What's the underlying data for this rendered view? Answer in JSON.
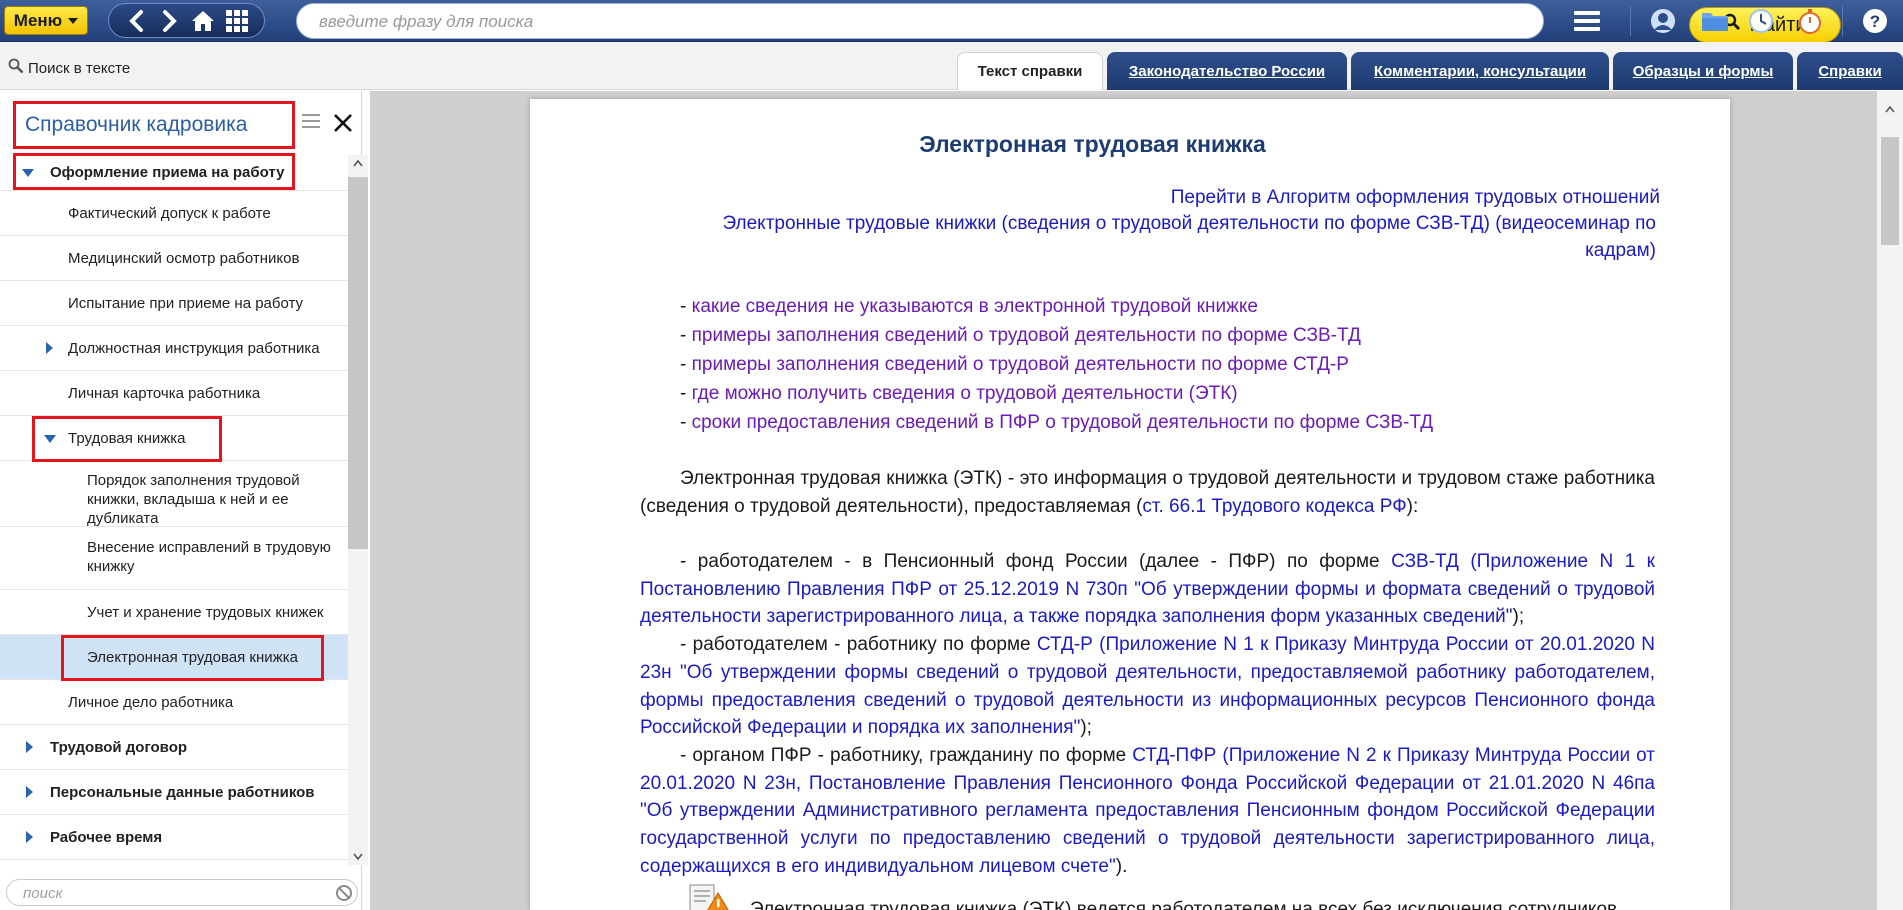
{
  "topbar": {
    "menu_label": "Меню",
    "search_placeholder": "введите фразу для поиска",
    "find_label": "Найти",
    "nav_icons": [
      "back-icon",
      "forward-icon",
      "home-icon",
      "grid-icon"
    ],
    "right_icons": [
      "hamburger-icon",
      "user-icon",
      "folder-icon",
      "clock-icon",
      "stopwatch-icon",
      "help-icon"
    ]
  },
  "toolbar": {
    "search_in_text": "Поиск в тексте",
    "tabs": [
      {
        "label": "Текст справки",
        "active": true
      },
      {
        "label": "Законодательство России",
        "active": false
      },
      {
        "label": "Комментарии, консультации",
        "active": false
      },
      {
        "label": "Образцы и формы",
        "active": false
      },
      {
        "label": "Справки",
        "active": false
      }
    ]
  },
  "sidebar": {
    "title": "Справочник кадровика",
    "search_placeholder": "поиск",
    "items": [
      {
        "label": "Оформление приема на работу",
        "level": 0,
        "expanded": true,
        "bold": true
      },
      {
        "label": "Фактический допуск к работе",
        "level": 1
      },
      {
        "label": "Медицинский осмотр работников",
        "level": 1
      },
      {
        "label": "Испытание при приеме на работу",
        "level": 1
      },
      {
        "label": "Должностная инструкция работника",
        "level": 1,
        "collapsed": true
      },
      {
        "label": "Личная карточка работника",
        "level": 1
      },
      {
        "label": "Трудовая книжка",
        "level": 1,
        "expanded": true
      },
      {
        "label": "Порядок заполнения трудовой книжки, вкладыша к ней и ее дубликата",
        "level": 2
      },
      {
        "label": "Внесение исправлений в трудовую книжку",
        "level": 2
      },
      {
        "label": "Учет и хранение трудовых книжек",
        "level": 2
      },
      {
        "label": "Электронная трудовая книжка",
        "level": 2,
        "selected": true
      },
      {
        "label": "Личное дело работника",
        "level": 1
      },
      {
        "label": "Трудовой договор",
        "level": 0,
        "collapsed": true,
        "bold": true
      },
      {
        "label": "Персональные данные работников",
        "level": 0,
        "collapsed": true,
        "bold": true
      },
      {
        "label": "Рабочее время",
        "level": 0,
        "collapsed": true,
        "bold": true
      }
    ]
  },
  "document": {
    "title": "Электронная трудовая книжка",
    "top_links": [
      "Перейти в Алгоритм оформления трудовых отношений",
      "Электронные трудовые книжки (сведения о трудовой деятельности по форме СЗВ-ТД) (видеосеминар по",
      "кадрам)"
    ],
    "bullet_prefix": "- ",
    "bullets": [
      "какие сведения не указываются в электронной трудовой книжке",
      "примеры заполнения сведений о трудовой деятельности по форме СЗВ-ТД",
      "примеры заполнения сведений о трудовой деятельности по форме СТД-Р",
      "где можно получить сведения о трудовой деятельности (ЭТК)",
      "сроки предоставления сведений в ПФР о трудовой деятельности по форме СЗВ-ТД"
    ],
    "intro": {
      "text_before": "Электронная трудовая книжка (ЭТК) - это информация о трудовой деятельности и трудовом стаже работника (сведения о трудовой деятельности), предоставляемая (",
      "link": "ст. 66.1 Трудового кодекса РФ",
      "text_after": "):"
    },
    "items": [
      {
        "before": "- работодателем - в Пенсионный фонд России (далее - ПФР) по форме ",
        "form": "СЗВ-ТД",
        "mid": " (",
        "ref": "Приложение N 1 к Постановлению Правления ПФР от 25.12.2019 N 730п \"Об утверждении формы и формата сведений о трудовой деятельности зарегистрированного лица, а также порядка заполнения форм указанных сведений\"",
        "end": ");"
      },
      {
        "before": "- работодателем - работнику по форме ",
        "form": "СТД-Р",
        "mid": " (",
        "ref": "Приложение N 1 к Приказу Минтруда России от 20.01.2020 N 23н \"Об утверждении формы сведений о трудовой деятельности, предоставляемой работнику работодателем, формы предоставления сведений о трудовой деятельности из информационных ресурсов Пенсионного фонда Российской Федерации и порядка их заполнения\"",
        "end": ");"
      },
      {
        "before": "- органом ПФР - работнику, гражданину по форме ",
        "form": "СТД-ПФР",
        "mid": " (",
        "ref": "Приложение N 2 к Приказу Минтруда России от 20.01.2020 N 23н, Постановление Правления Пенсионного Фонда Российской Федерации от 21.01.2020 N 46па \"Об утверждении Административного регламента предоставления Пенсионным фондом Российской Федерации государственной услуги по предоставлению сведений о трудовой деятельности зарегистрированного лица, содержащихся в его индивидуальном лицевом счете\"",
        "end": ")."
      }
    ],
    "note": {
      "before": "Электронная трудовая книжка (ЭТК) ведется работодателем ",
      "underlined": "на всех без исключения",
      "after": " сотрудников"
    }
  },
  "colors": {
    "topbar": "#22407a",
    "accent_yellow": "#f6cf00",
    "highlight_red": "#e4151c",
    "link_blue": "#1a1ac8",
    "visited_purple": "#6b1bb8",
    "selected_row": "#d0e2f6"
  }
}
